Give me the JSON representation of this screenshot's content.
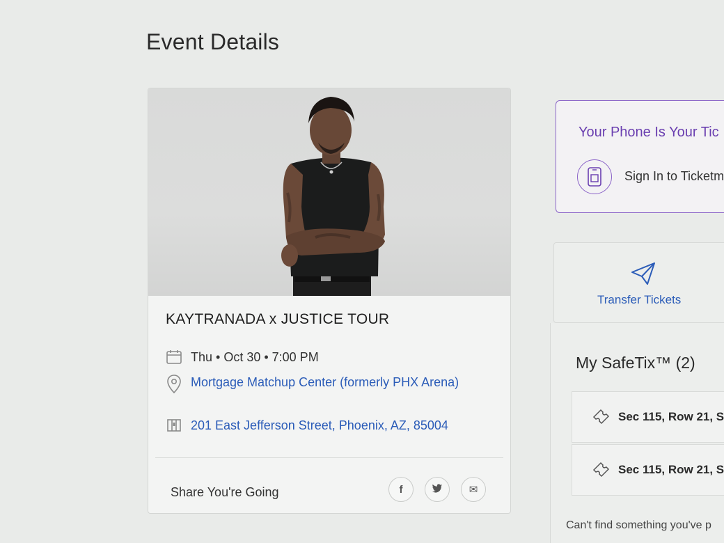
{
  "page": {
    "title": "Event Details"
  },
  "event": {
    "title": "KAYTRANADA x JUSTICE TOUR",
    "date_time": "Thu • Oct 30 • 7:00 PM",
    "venue": "Mortgage Matchup Center (formerly PHX Arena)",
    "address": "201 East Jefferson Street, Phoenix, AZ, 85004",
    "icons": [
      "calendar-icon",
      "location-pin-icon",
      "map-icon"
    ]
  },
  "share": {
    "label": "Share You're Going",
    "buttons": [
      {
        "name": "facebook",
        "glyph": "f"
      },
      {
        "name": "twitter",
        "glyph": "t"
      },
      {
        "name": "email",
        "glyph": "✉"
      }
    ]
  },
  "phone_card": {
    "title": "Your Phone Is Your Tic",
    "signin_text": "Sign In to Ticketm",
    "accent": "#6a3fb0"
  },
  "transfer": {
    "label": "Transfer Tickets",
    "color": "#2b5cb8"
  },
  "safetix": {
    "title": "My SafeTix™",
    "count": "(2)",
    "tickets": [
      {
        "label": "Sec 115, Row 21, S"
      },
      {
        "label": "Sec 115, Row 21, Se"
      }
    ],
    "footer": "Can't find something you've p"
  }
}
